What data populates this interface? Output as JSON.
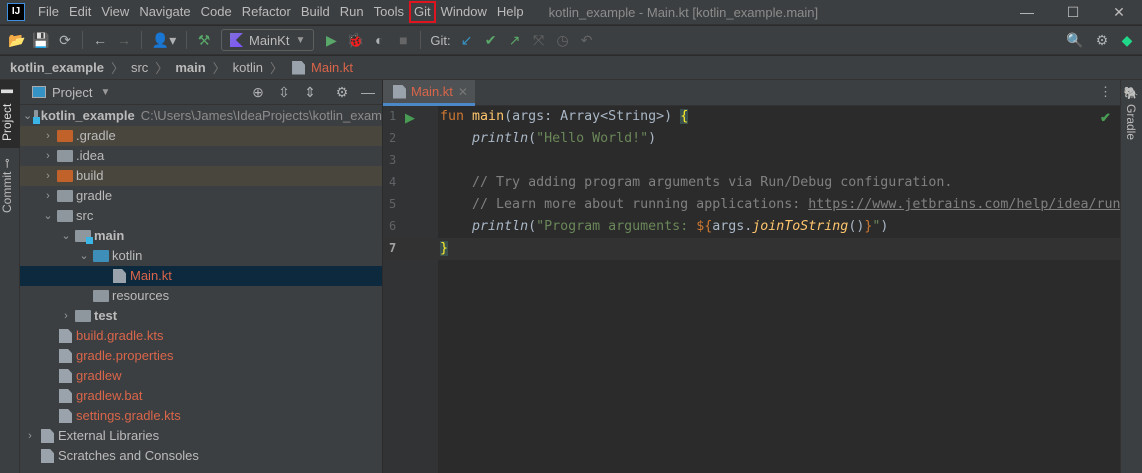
{
  "menubar": {
    "logo": "IJ",
    "items": [
      "File",
      "Edit",
      "View",
      "Navigate",
      "Code",
      "Refactor",
      "Build",
      "Run",
      "Tools",
      "Git",
      "Window",
      "Help"
    ],
    "highlighted": "Git",
    "title": "kotlin_example - Main.kt [kotlin_example.main]"
  },
  "toolbar": {
    "run_config": "MainKt",
    "git_label": "Git:"
  },
  "breadcrumb": [
    "kotlin_example",
    "src",
    "main",
    "kotlin",
    "Main.kt"
  ],
  "sidebar": {
    "project_tab": "Project",
    "commit_tab": "Commit",
    "gradle_tab": "Gradle"
  },
  "project": {
    "title": "Project",
    "root": {
      "name": "kotlin_example",
      "path": "C:\\Users\\James\\IdeaProjects\\kotlin_exam"
    },
    "items": [
      ".gradle",
      ".idea",
      "build",
      "gradle",
      "src",
      "main",
      "kotlin",
      "Main.kt",
      "resources",
      "test",
      "build.gradle.kts",
      "gradle.properties",
      "gradlew",
      "gradlew.bat",
      "settings.gradle.kts",
      "External Libraries",
      "Scratches and Consoles"
    ]
  },
  "editor": {
    "tab": "Main.kt",
    "lines": [
      "1",
      "2",
      "3",
      "4",
      "5",
      "6",
      "7"
    ],
    "code": {
      "l1a": "fun",
      "l1b": "main",
      "l1c": "(args: Array<String>) ",
      "l1d": "{",
      "l2a": "println",
      "l2b": "(",
      "l2c": "\"Hello World!\"",
      "l2d": ")",
      "l4": "// Try adding program arguments via Run/Debug configuration.",
      "l5a": "// Learn more about running applications: ",
      "l5b": "https://www.jetbrains.com/help/idea/run",
      "l6a": "println",
      "l6b": "(",
      "l6c": "\"Program arguments: ",
      "l6d": "${",
      "l6e": "args.",
      "l6f": "joinToString",
      "l6g": "()",
      "l6h": "}",
      "l6i": "\"",
      "l6j": ")",
      "l7": "}"
    }
  },
  "colors": {
    "accent": "#4a88c7",
    "highlight_box": "#e0141e",
    "modified_folder": "#c2622b",
    "unversioned_file": "#d9654a"
  }
}
